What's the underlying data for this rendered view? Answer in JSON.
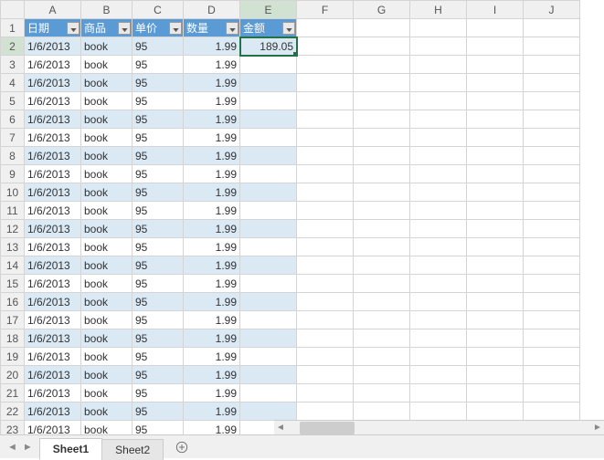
{
  "columns": [
    "A",
    "B",
    "C",
    "D",
    "E",
    "F",
    "G",
    "H",
    "I",
    "J"
  ],
  "header_row_num": "1",
  "headers": {
    "A": "日期",
    "B": "商品",
    "C": "单价",
    "D": "数量",
    "E": "金额"
  },
  "selected_cell": {
    "row": 2,
    "col": "E"
  },
  "rows": [
    {
      "n": 2,
      "A": "1/6/2013",
      "B": "book",
      "C": "95",
      "D": "1.99",
      "E": "189.05",
      "band": true
    },
    {
      "n": 3,
      "A": "1/6/2013",
      "B": "book",
      "C": "95",
      "D": "1.99",
      "E": "",
      "band": false
    },
    {
      "n": 4,
      "A": "1/6/2013",
      "B": "book",
      "C": "95",
      "D": "1.99",
      "E": "",
      "band": true
    },
    {
      "n": 5,
      "A": "1/6/2013",
      "B": "book",
      "C": "95",
      "D": "1.99",
      "E": "",
      "band": false
    },
    {
      "n": 6,
      "A": "1/6/2013",
      "B": "book",
      "C": "95",
      "D": "1.99",
      "E": "",
      "band": true
    },
    {
      "n": 7,
      "A": "1/6/2013",
      "B": "book",
      "C": "95",
      "D": "1.99",
      "E": "",
      "band": false
    },
    {
      "n": 8,
      "A": "1/6/2013",
      "B": "book",
      "C": "95",
      "D": "1.99",
      "E": "",
      "band": true
    },
    {
      "n": 9,
      "A": "1/6/2013",
      "B": "book",
      "C": "95",
      "D": "1.99",
      "E": "",
      "band": false
    },
    {
      "n": 10,
      "A": "1/6/2013",
      "B": "book",
      "C": "95",
      "D": "1.99",
      "E": "",
      "band": true
    },
    {
      "n": 11,
      "A": "1/6/2013",
      "B": "book",
      "C": "95",
      "D": "1.99",
      "E": "",
      "band": false
    },
    {
      "n": 12,
      "A": "1/6/2013",
      "B": "book",
      "C": "95",
      "D": "1.99",
      "E": "",
      "band": true
    },
    {
      "n": 13,
      "A": "1/6/2013",
      "B": "book",
      "C": "95",
      "D": "1.99",
      "E": "",
      "band": false
    },
    {
      "n": 14,
      "A": "1/6/2013",
      "B": "book",
      "C": "95",
      "D": "1.99",
      "E": "",
      "band": true
    },
    {
      "n": 15,
      "A": "1/6/2013",
      "B": "book",
      "C": "95",
      "D": "1.99",
      "E": "",
      "band": false
    },
    {
      "n": 16,
      "A": "1/6/2013",
      "B": "book",
      "C": "95",
      "D": "1.99",
      "E": "",
      "band": true
    },
    {
      "n": 17,
      "A": "1/6/2013",
      "B": "book",
      "C": "95",
      "D": "1.99",
      "E": "",
      "band": false
    },
    {
      "n": 18,
      "A": "1/6/2013",
      "B": "book",
      "C": "95",
      "D": "1.99",
      "E": "",
      "band": true
    },
    {
      "n": 19,
      "A": "1/6/2013",
      "B": "book",
      "C": "95",
      "D": "1.99",
      "E": "",
      "band": false
    },
    {
      "n": 20,
      "A": "1/6/2013",
      "B": "book",
      "C": "95",
      "D": "1.99",
      "E": "",
      "band": true
    },
    {
      "n": 21,
      "A": "1/6/2013",
      "B": "book",
      "C": "95",
      "D": "1.99",
      "E": "",
      "band": false
    },
    {
      "n": 22,
      "A": "1/6/2013",
      "B": "book",
      "C": "95",
      "D": "1.99",
      "E": "",
      "band": true
    },
    {
      "n": 23,
      "A": "1/6/2013",
      "B": "book",
      "C": "95",
      "D": "1.99",
      "E": "",
      "band": false
    }
  ],
  "tabs": [
    {
      "label": "Sheet1",
      "active": true
    },
    {
      "label": "Sheet2",
      "active": false
    }
  ],
  "icons": {
    "add_sheet": "plus-circle-icon",
    "filter": "chevron-down-icon"
  }
}
